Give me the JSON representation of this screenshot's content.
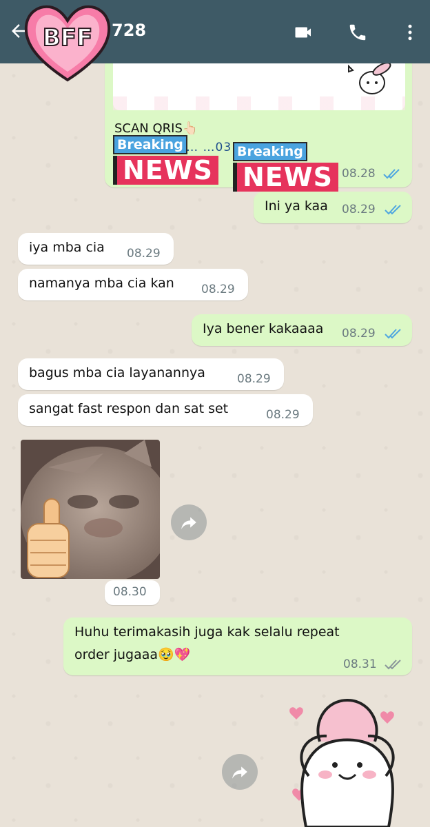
{
  "header": {
    "title_suffix": "728",
    "sticker_label": "BFF",
    "bg_color": "#3e5a66"
  },
  "scan_message": {
    "text": "SCAN QRIS👆🏻",
    "sub": "2…  …5 || 0…  …03",
    "time": "08.28",
    "status": "read"
  },
  "breaking_news": {
    "top": "Breaking",
    "bottom": "NEWS"
  },
  "messages": [
    {
      "dir": "out",
      "text": "Ini ya kaa",
      "time": "08.29",
      "status": "read"
    },
    {
      "dir": "in",
      "text": "iya mba cia",
      "time": "08.29"
    },
    {
      "dir": "in",
      "text": "namanya mba cia kan",
      "time": "08.29"
    },
    {
      "dir": "out",
      "text": "Iya bener kakaaaa",
      "time": "08.29",
      "status": "read"
    },
    {
      "dir": "in",
      "text": "bagus mba cia layanannya",
      "time": "08.29"
    },
    {
      "dir": "in",
      "text": "sangat fast respon dan sat set",
      "time": "08.29"
    },
    {
      "dir": "in",
      "type": "image",
      "image": "cat-thumbs-up",
      "time": "08.30"
    },
    {
      "dir": "out",
      "text": "Huhu terimakasih juga kak selalu repeat",
      "text2": "order jugaaa🥹💖",
      "time": "08.31",
      "status": "delivered"
    },
    {
      "dir": "in",
      "type": "sticker",
      "image": "girl-heart-hands"
    }
  ],
  "colors": {
    "incoming": "#ffffff",
    "outgoing": "#dcf8c6",
    "read_tick": "#4fa6e0",
    "delivered_tick": "#8a969a"
  }
}
